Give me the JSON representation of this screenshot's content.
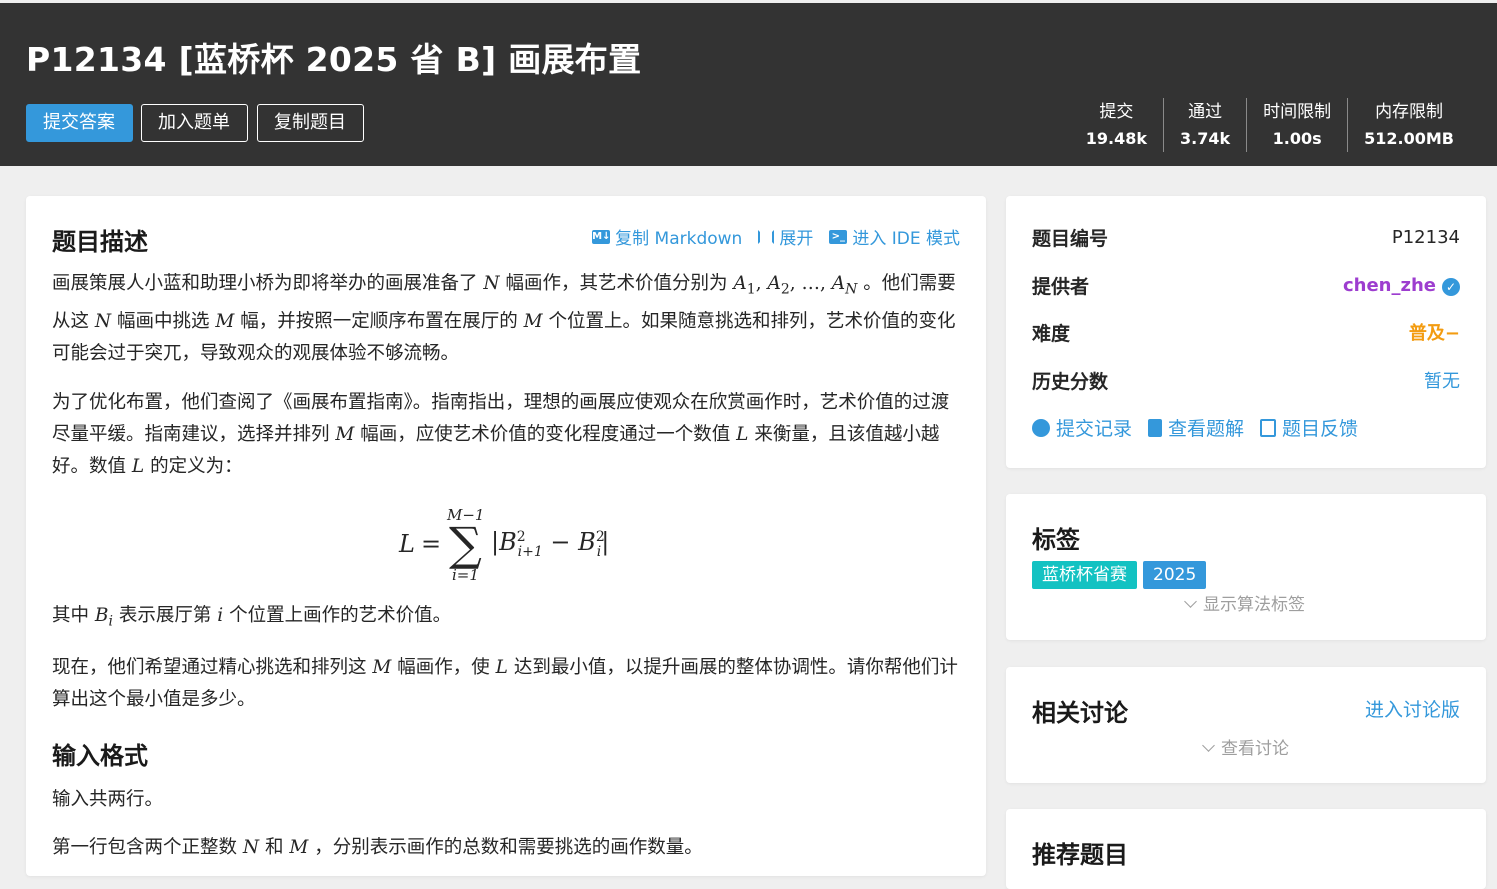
{
  "header": {
    "title": "P12134 [蓝桥杯 2025 省 B] 画展布置",
    "buttons": {
      "submit": "提交答案",
      "add_list": "加入题单",
      "copy": "复制题目"
    },
    "stats": [
      {
        "label": "提交",
        "value": "19.48k"
      },
      {
        "label": "通过",
        "value": "3.74k"
      },
      {
        "label": "时间限制",
        "value": "1.00s"
      },
      {
        "label": "内存限制",
        "value": "512.00MB"
      }
    ]
  },
  "problem": {
    "section_desc": "题目描述",
    "actions": {
      "copy_md": "复制 Markdown",
      "expand": "展开",
      "ide": "进入 IDE 模式"
    },
    "p1a": "画展策展人小蓝和助理小桥为即将举办的画展准备了",
    "p1b": "幅画作，其艺术价值分别为",
    "p1c": "。他们需要从这",
    "p1d": "幅画中挑选",
    "p1e": "幅，并按照一定顺序布置在展厅的",
    "p1f": "个位置上。如果随意挑选和排列，艺术价值的变化可能会过于突兀，导致观众的观展体验不够流畅。",
    "p2a": "为了优化布置，他们查阅了《画展布置指南》。指南指出，理想的画展应使观众在欣赏画作时，艺术价值的过渡尽量平缓。指南建议，选择并排列",
    "p2b": "幅画，应使艺术价值的变化程度通过一个数值",
    "p2c": "来衡量，且该值越小越好。数值",
    "p2d": "的定义为：",
    "p3a": "其中",
    "p3b": "表示展厅第",
    "p3c": "个位置上画作的艺术价值。",
    "p4a": "现在，他们希望通过精心挑选和排列这",
    "p4b": "幅画作，使",
    "p4c": "达到最小值，以提升画展的整体协调性。请你帮他们计算出这个最小值是多少。",
    "section_input": "输入格式",
    "p5": "输入共两行。",
    "p6a": "第一行包含两个正整数",
    "p6b": "和",
    "p6c": "，分别表示画作的总数和需要挑选的画作数量。",
    "math": {
      "N": "N",
      "M": "M",
      "L": "L",
      "B": "B",
      "i": "i",
      "A": "A",
      "one": "1",
      "two": "2",
      "dots": "…",
      "comma": ", ",
      "Msub1": "M−1",
      "ieq1": "i=1",
      "ip1": "i+1",
      "sigma": "∑",
      "eq": "=",
      "minus": "−",
      "bar": "|"
    }
  },
  "sidebar": {
    "info": {
      "id_label": "题目编号",
      "id_value": "P12134",
      "author_label": "提供者",
      "author_value": "chen_zhe",
      "difficulty_label": "难度",
      "difficulty_value": "普及−",
      "score_label": "历史分数",
      "score_value": "暂无",
      "links": {
        "records": "提交记录",
        "solutions": "查看题解",
        "feedback": "题目反馈"
      }
    },
    "tags": {
      "title": "标签",
      "items": [
        {
          "label": "蓝桥杯省赛",
          "color": "#13c2c2"
        },
        {
          "label": "2025",
          "color": "#3498db"
        }
      ],
      "show_algo": "显示算法标签"
    },
    "discuss": {
      "title": "相关讨论",
      "enter": "进入讨论版",
      "view": "查看讨论"
    },
    "recommend": {
      "title": "推荐题目"
    }
  },
  "colors": {
    "header_bg": "#333333",
    "primary": "#3498db",
    "author": "#9d3dcf",
    "difficulty": "#f39c11",
    "page_bg": "#efefef"
  }
}
